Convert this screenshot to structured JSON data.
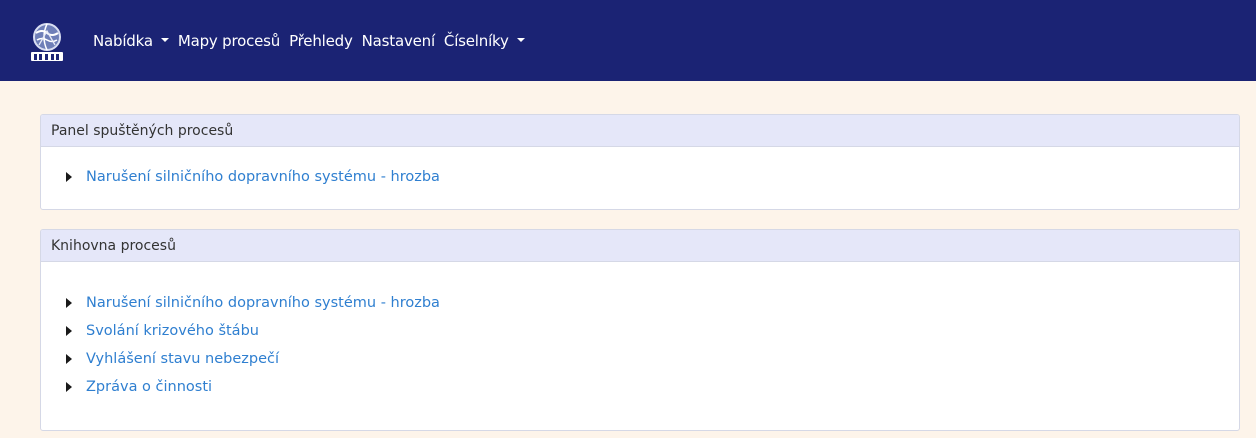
{
  "navbar": {
    "logo_icon": "globe-logo-icon",
    "items": [
      {
        "label": "Nabídka",
        "dropdown": true
      },
      {
        "label": "Mapy procesů",
        "dropdown": false
      },
      {
        "label": "Přehledy",
        "dropdown": false
      },
      {
        "label": "Nastavení",
        "dropdown": false
      },
      {
        "label": "Číselníky",
        "dropdown": true
      }
    ]
  },
  "panels": {
    "running": {
      "title": "Panel spuštěných procesů",
      "items": [
        "Narušení silničního dopravního systému - hrozba"
      ]
    },
    "library": {
      "title": "Knihovna procesů",
      "items": [
        "Narušení silničního dopravního systému - hrozba",
        "Svolání krizového štábu",
        "Vyhlášení stavu nebezpečí",
        "Zpráva o činnosti"
      ]
    }
  },
  "colors": {
    "navbar_bg": "#1b2374",
    "page_bg": "#fdf4ea",
    "card_header_bg": "#e5e7f9",
    "link": "#2f7fd0"
  }
}
